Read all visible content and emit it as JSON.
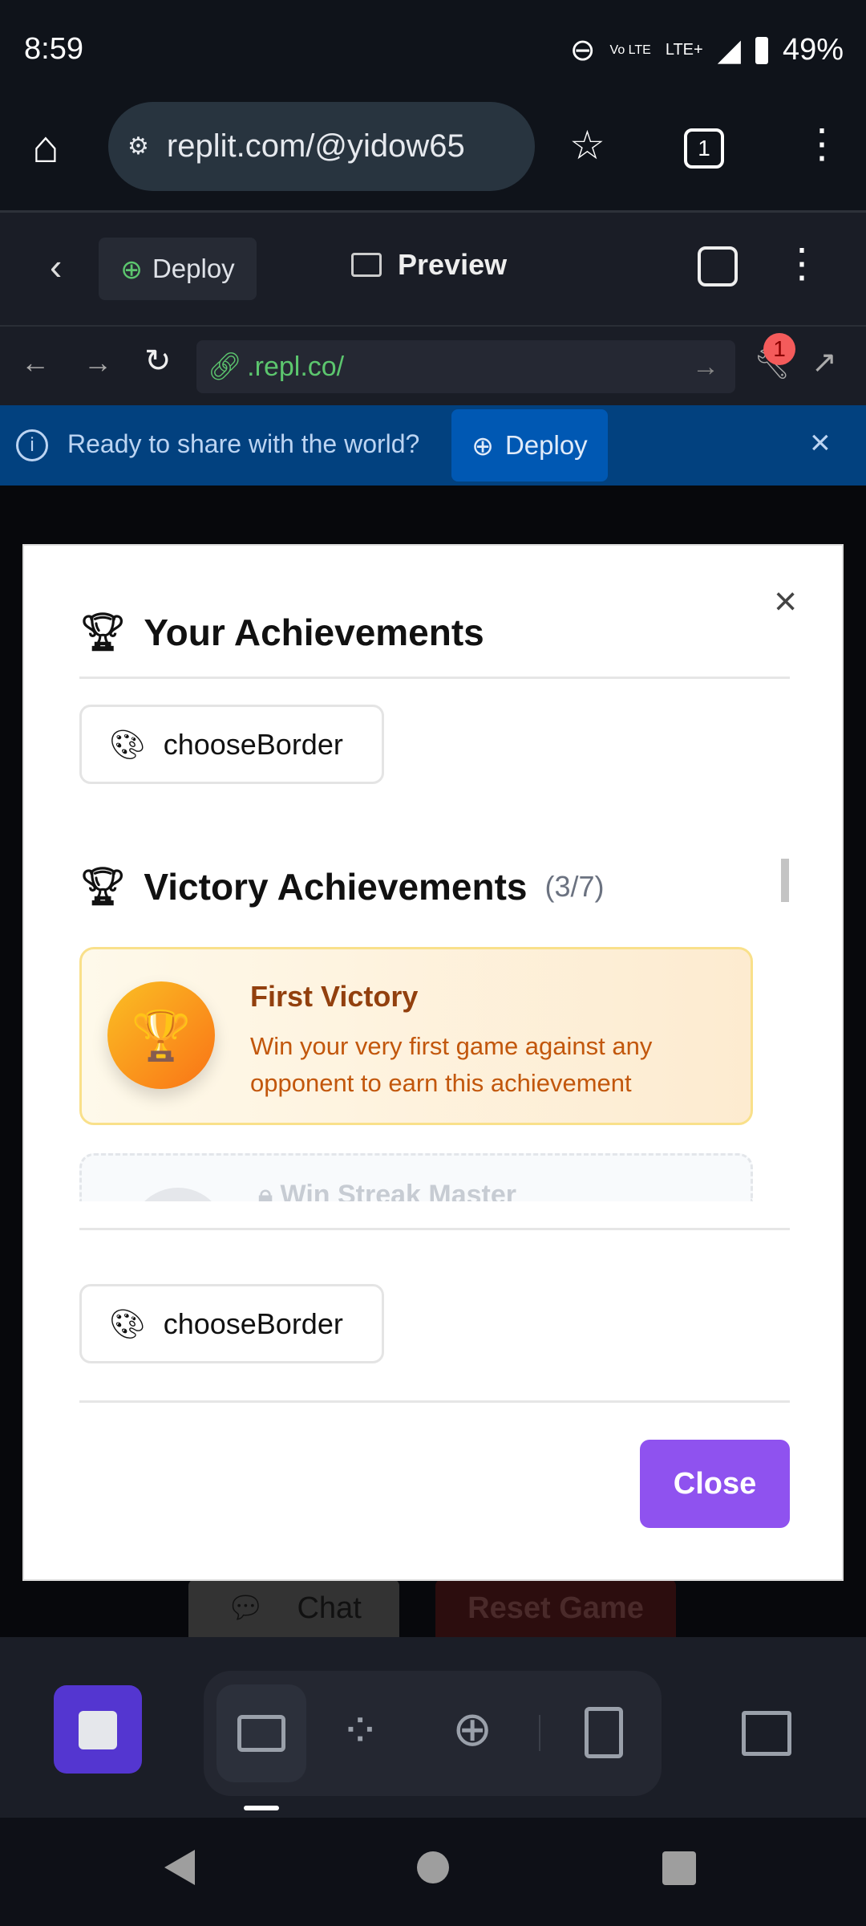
{
  "status_bar": {
    "time": "8:59",
    "network": "LTE+",
    "volte": "Vo LTE",
    "battery": "49%"
  },
  "browser": {
    "url": "replit.com/@yidow65",
    "tab_count": "1"
  },
  "replit_header": {
    "deploy_label": "Deploy",
    "title": "Preview"
  },
  "preview_bar": {
    "url": ".repl.co/",
    "badge_count": "1"
  },
  "banner": {
    "text": "Ready to share with the world?",
    "deploy_label": "Deploy"
  },
  "modal": {
    "title": "Your Achievements",
    "chip_top": "chooseBorder",
    "section_title": "Victory Achievements",
    "section_count": "(3/7)",
    "achievements": [
      {
        "title": "First Victory",
        "description": "Win your very first game against any opponent to earn this achievement",
        "unlocked": true
      },
      {
        "title": "Win Streak Master",
        "unlocked": false
      }
    ],
    "chip_bottom": "chooseBorder",
    "close_label": "Close"
  },
  "background": {
    "chat_label": "Chat",
    "reset_label": "Reset Game"
  },
  "colors": {
    "accent": "#8f52ef",
    "banner": "#02417f",
    "stop": "#5436d0"
  }
}
